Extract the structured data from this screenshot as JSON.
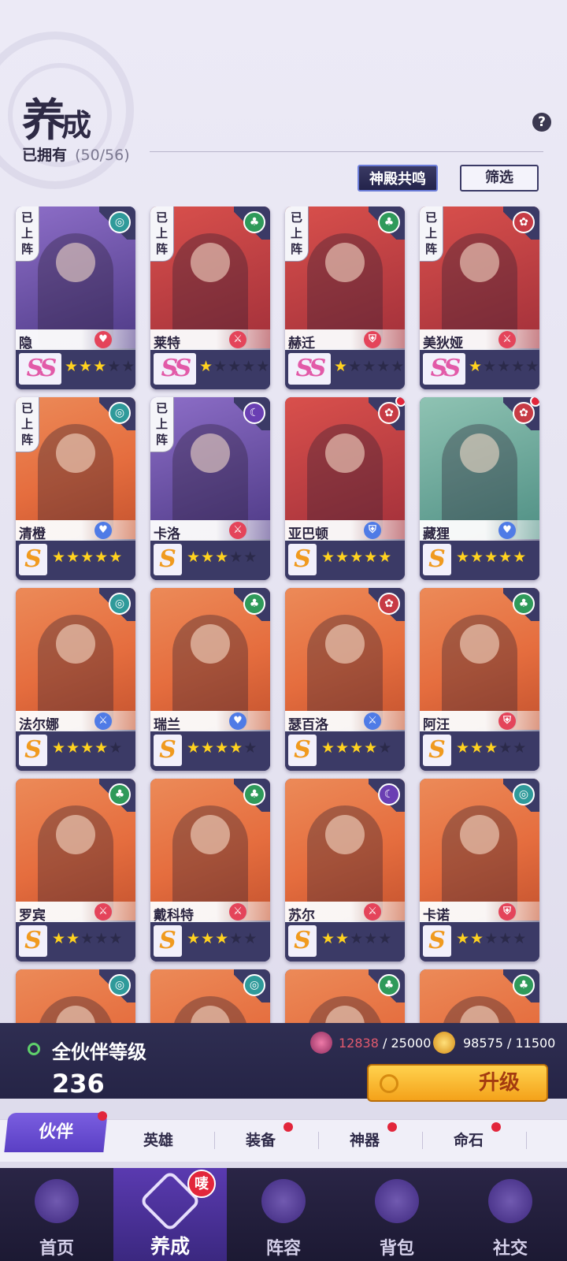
{
  "header": {
    "title_main": "养",
    "title_small": "成",
    "owned_label": "已拥有",
    "owned_count": "(50/56)",
    "help": "?",
    "resonance_button": "神殿共鸣",
    "filter_button": "筛选"
  },
  "deployed_badge": "已上阵",
  "heroes": [
    {
      "name": "隐",
      "rank": "SS",
      "stars": 3,
      "deployed": true,
      "element": "water",
      "role": "heart",
      "role_glyph": "♥",
      "element_glyph": "◎",
      "art": "violet",
      "dot": false
    },
    {
      "name": "莱特",
      "rank": "SS",
      "stars": 1,
      "deployed": true,
      "element": "wood",
      "role": "sword",
      "role_glyph": "⚔",
      "element_glyph": "♣",
      "art": "red",
      "dot": false
    },
    {
      "name": "赫迁",
      "rank": "SS",
      "stars": 1,
      "deployed": true,
      "element": "wood",
      "role": "shield",
      "role_glyph": "⛨",
      "element_glyph": "♣",
      "art": "red",
      "dot": false
    },
    {
      "name": "美狄娅",
      "rank": "SS",
      "stars": 1,
      "deployed": true,
      "element": "fire",
      "role": "sword",
      "role_glyph": "⚔",
      "element_glyph": "✿",
      "art": "red",
      "dot": false
    },
    {
      "name": "清橙",
      "rank": "S",
      "stars": 5,
      "deployed": true,
      "element": "water",
      "role": "heal",
      "role_glyph": "♥",
      "element_glyph": "◎",
      "art": "orange",
      "dot": false
    },
    {
      "name": "卡洛",
      "rank": "S",
      "stars": 3,
      "deployed": true,
      "element": "dark",
      "role": "sword",
      "role_glyph": "⚔",
      "element_glyph": "☾",
      "art": "violet",
      "dot": false
    },
    {
      "name": "亚巴顿",
      "rank": "S",
      "stars": 5,
      "deployed": false,
      "element": "fire",
      "role": "blue",
      "role_glyph": "⛨",
      "element_glyph": "✿",
      "art": "red",
      "dot": true
    },
    {
      "name": "藏狸",
      "rank": "S",
      "stars": 5,
      "deployed": false,
      "element": "fire",
      "role": "heal",
      "role_glyph": "♥",
      "element_glyph": "✿",
      "art": "teal",
      "dot": true
    },
    {
      "name": "法尔娜",
      "rank": "S",
      "stars": 4,
      "deployed": false,
      "element": "water",
      "role": "blue",
      "role_glyph": "⚔",
      "element_glyph": "◎",
      "art": "orange",
      "dot": false
    },
    {
      "name": "瑞兰",
      "rank": "S",
      "stars": 4,
      "deployed": false,
      "element": "wood",
      "role": "heal",
      "role_glyph": "♥",
      "element_glyph": "♣",
      "art": "orange",
      "dot": false
    },
    {
      "name": "瑟百洛",
      "rank": "S",
      "stars": 4,
      "deployed": false,
      "element": "fire",
      "role": "blue",
      "role_glyph": "⚔",
      "element_glyph": "✿",
      "art": "orange",
      "dot": false
    },
    {
      "name": "阿汪",
      "rank": "S",
      "stars": 3,
      "deployed": false,
      "element": "wood",
      "role": "shield",
      "role_glyph": "⛨",
      "element_glyph": "♣",
      "art": "orange",
      "dot": false
    },
    {
      "name": "罗宾",
      "rank": "S",
      "stars": 2,
      "deployed": false,
      "element": "wood",
      "role": "sword",
      "role_glyph": "⚔",
      "element_glyph": "♣",
      "art": "orange",
      "dot": false
    },
    {
      "name": "戴科特",
      "rank": "S",
      "stars": 3,
      "deployed": false,
      "element": "wood",
      "role": "sword",
      "role_glyph": "⚔",
      "element_glyph": "♣",
      "art": "orange",
      "dot": false
    },
    {
      "name": "苏尔",
      "rank": "S",
      "stars": 2,
      "deployed": false,
      "element": "dark",
      "role": "sword",
      "role_glyph": "⚔",
      "element_glyph": "☾",
      "art": "orange",
      "dot": false
    },
    {
      "name": "卡诺",
      "rank": "S",
      "stars": 2,
      "deployed": false,
      "element": "water",
      "role": "shield",
      "role_glyph": "⛨",
      "element_glyph": "◎",
      "art": "orange",
      "dot": false
    },
    {
      "name": "",
      "rank": "",
      "stars": 0,
      "deployed": false,
      "element": "water",
      "role": "",
      "role_glyph": "",
      "element_glyph": "◎",
      "art": "orange",
      "dot": false
    },
    {
      "name": "",
      "rank": "",
      "stars": 0,
      "deployed": false,
      "element": "water",
      "role": "",
      "role_glyph": "",
      "element_glyph": "◎",
      "art": "orange",
      "dot": false
    },
    {
      "name": "",
      "rank": "",
      "stars": 0,
      "deployed": false,
      "element": "wood",
      "role": "",
      "role_glyph": "",
      "element_glyph": "♣",
      "art": "orange",
      "dot": false
    },
    {
      "name": "",
      "rank": "",
      "stars": 0,
      "deployed": false,
      "element": "wood",
      "role": "",
      "role_glyph": "",
      "element_glyph": "♣",
      "art": "orange",
      "dot": false
    }
  ],
  "level_panel": {
    "label": "全伙伴等级",
    "value": "236",
    "resource1_current": "12838",
    "resource1_max": " / 25000",
    "resource2": "98575 / 11500",
    "upgrade_button": "升级"
  },
  "subtabs": [
    {
      "label": "伙伴",
      "active": true,
      "dot": true
    },
    {
      "label": "英雄",
      "active": false,
      "dot": false
    },
    {
      "label": "装备",
      "active": false,
      "dot": true
    },
    {
      "label": "神器",
      "active": false,
      "dot": true
    },
    {
      "label": "命石",
      "active": false,
      "dot": true
    }
  ],
  "nav": [
    {
      "label": "首页",
      "icon": "home-icon",
      "active": false
    },
    {
      "label": "养成",
      "icon": "develop-icon",
      "active": true,
      "badge": "唛"
    },
    {
      "label": "阵容",
      "icon": "lineup-icon",
      "active": false
    },
    {
      "label": "背包",
      "icon": "bag-icon",
      "active": false
    },
    {
      "label": "社交",
      "icon": "social-icon",
      "active": false
    }
  ],
  "colors": {
    "panel": "#3b3a66",
    "accent": "#6a4fd0",
    "star_on": "#ffd21f",
    "rank_ss": "#e25aa8",
    "rank_s": "#f09a1f"
  }
}
